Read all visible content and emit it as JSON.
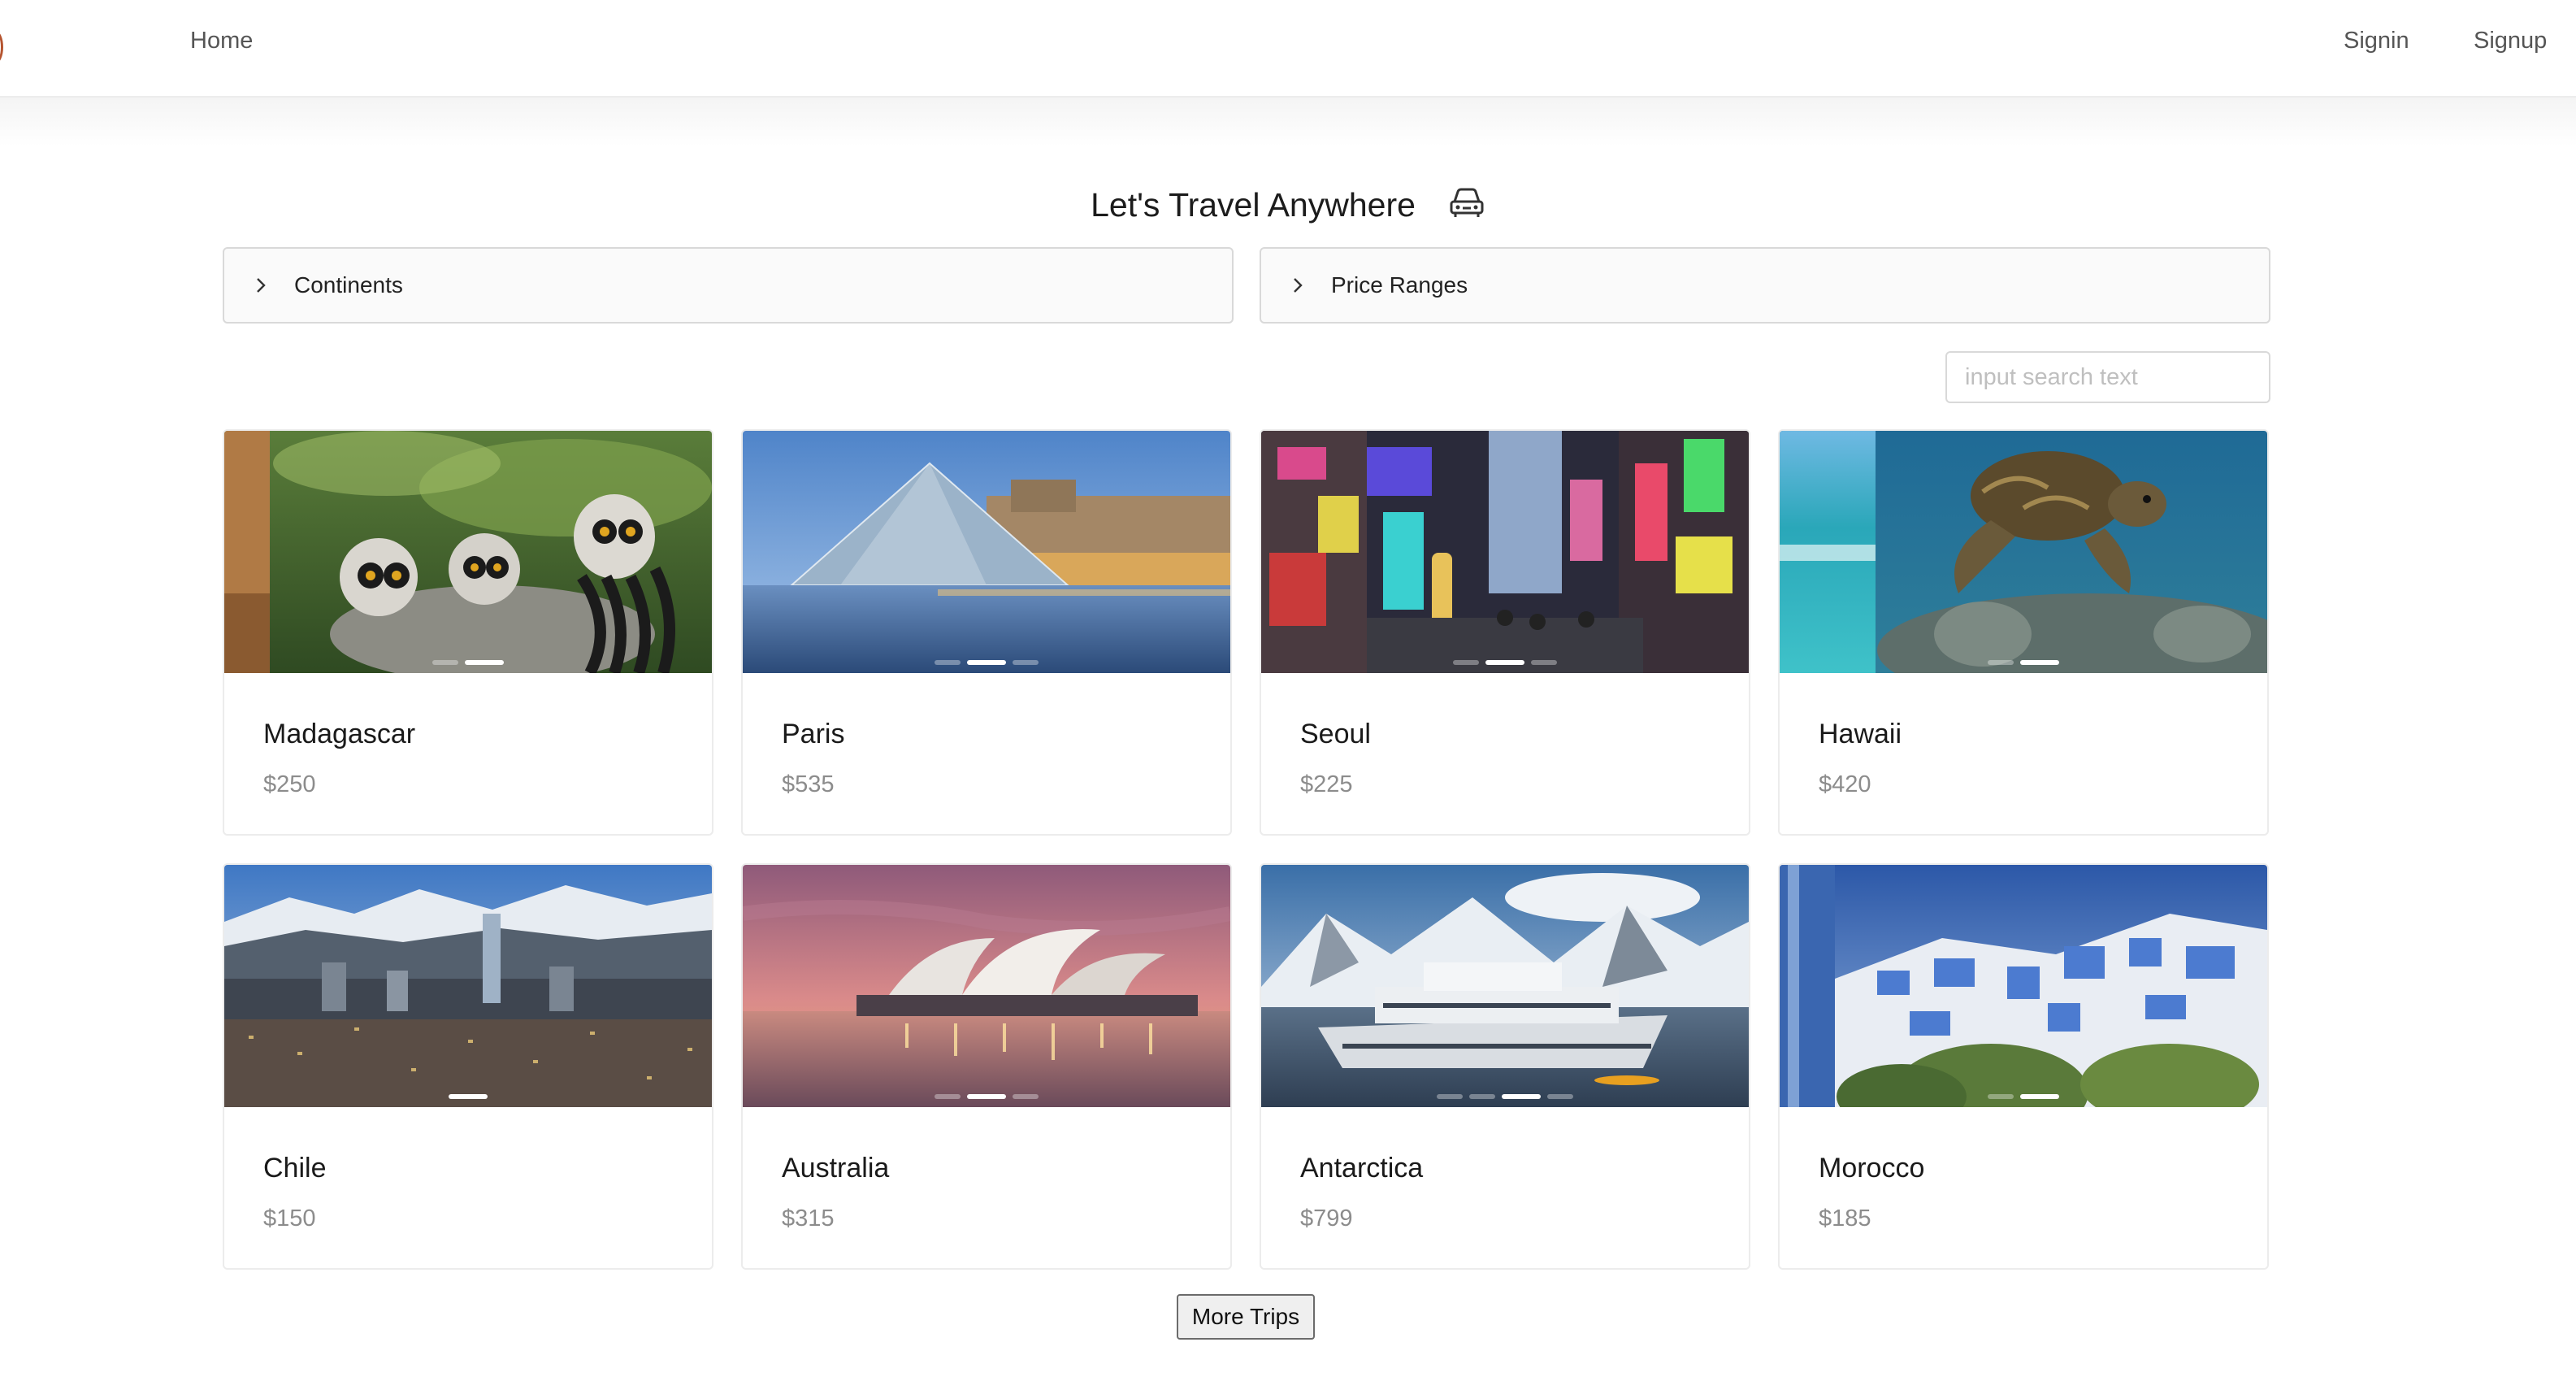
{
  "nav": {
    "home": "Home",
    "signin": "Signin",
    "signup": "Signup"
  },
  "hero": {
    "title": "Let's Travel Anywhere",
    "icon": "car-icon"
  },
  "filters": {
    "continents": "Continents",
    "price_ranges": "Price Ranges"
  },
  "search": {
    "placeholder": "input search text",
    "value": ""
  },
  "trips": [
    {
      "name": "Madagascar",
      "price": "$250",
      "carousel_slides": 2,
      "active_slide": 2
    },
    {
      "name": "Paris",
      "price": "$535",
      "carousel_slides": 3,
      "active_slide": 2
    },
    {
      "name": "Seoul",
      "price": "$225",
      "carousel_slides": 3,
      "active_slide": 2
    },
    {
      "name": "Hawaii",
      "price": "$420",
      "carousel_slides": 2,
      "active_slide": 2
    },
    {
      "name": "Chile",
      "price": "$150",
      "carousel_slides": 1,
      "active_slide": 1
    },
    {
      "name": "Australia",
      "price": "$315",
      "carousel_slides": 3,
      "active_slide": 2
    },
    {
      "name": "Antarctica",
      "price": "$799",
      "carousel_slides": 4,
      "active_slide": 3
    },
    {
      "name": "Morocco",
      "price": "$185",
      "carousel_slides": 2,
      "active_slide": 2
    }
  ],
  "more_button": "More Trips",
  "colors": {
    "page_background": "#ffffff",
    "card_border": "#ececec",
    "price_text": "#8c8c8c",
    "collapse_background": "#fafafa"
  }
}
